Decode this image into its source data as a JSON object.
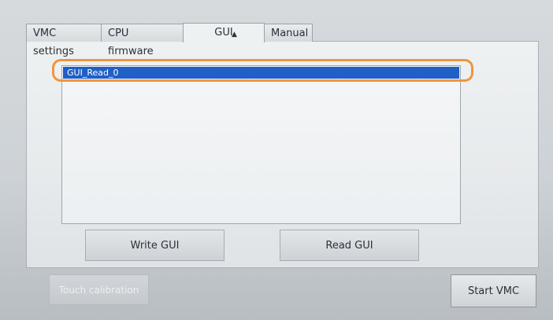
{
  "tabs": [
    {
      "label": "VMC settings"
    },
    {
      "label": "CPU firmware"
    },
    {
      "label": "GUI",
      "active": true
    },
    {
      "label": "Manual"
    }
  ],
  "gui_list": {
    "items": [
      {
        "label": "GUI_Read_0",
        "selected": true
      }
    ]
  },
  "buttons": {
    "write_gui": "Write GUI",
    "read_gui": "Read GUI",
    "touch_calibration": "Touch calibration",
    "start_vmc": "Start VMC"
  },
  "colors": {
    "selection": "#1f5fc6",
    "annotation_ring": "#f0953c"
  },
  "icons": {
    "cursor": "mouse-cursor-icon"
  }
}
